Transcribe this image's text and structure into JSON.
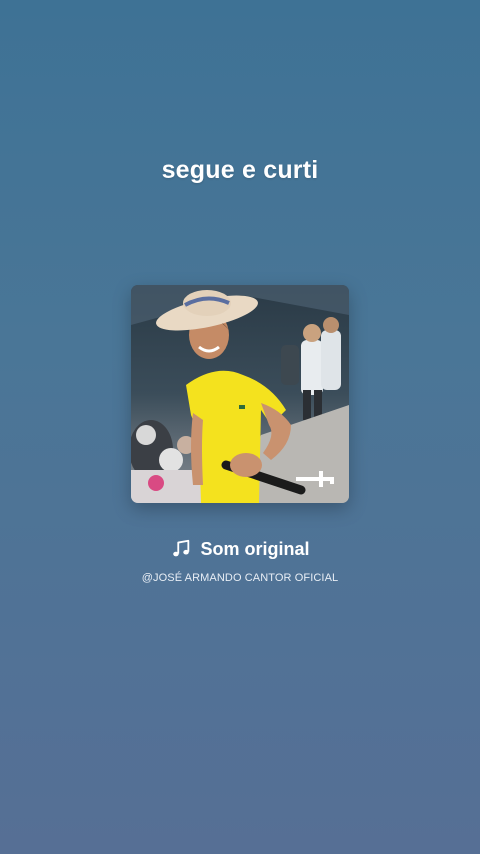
{
  "caption": "segue e curti",
  "cover": {
    "description_icon": "album-cover-image"
  },
  "sound": {
    "icon": "music-note-icon",
    "title": "Som original",
    "author": "@JOSÉ ARMANDO CANTOR OFICIAL"
  },
  "colors": {
    "background_top": "#3e7295",
    "background_bottom": "#566f95",
    "text": "#ffffff"
  }
}
